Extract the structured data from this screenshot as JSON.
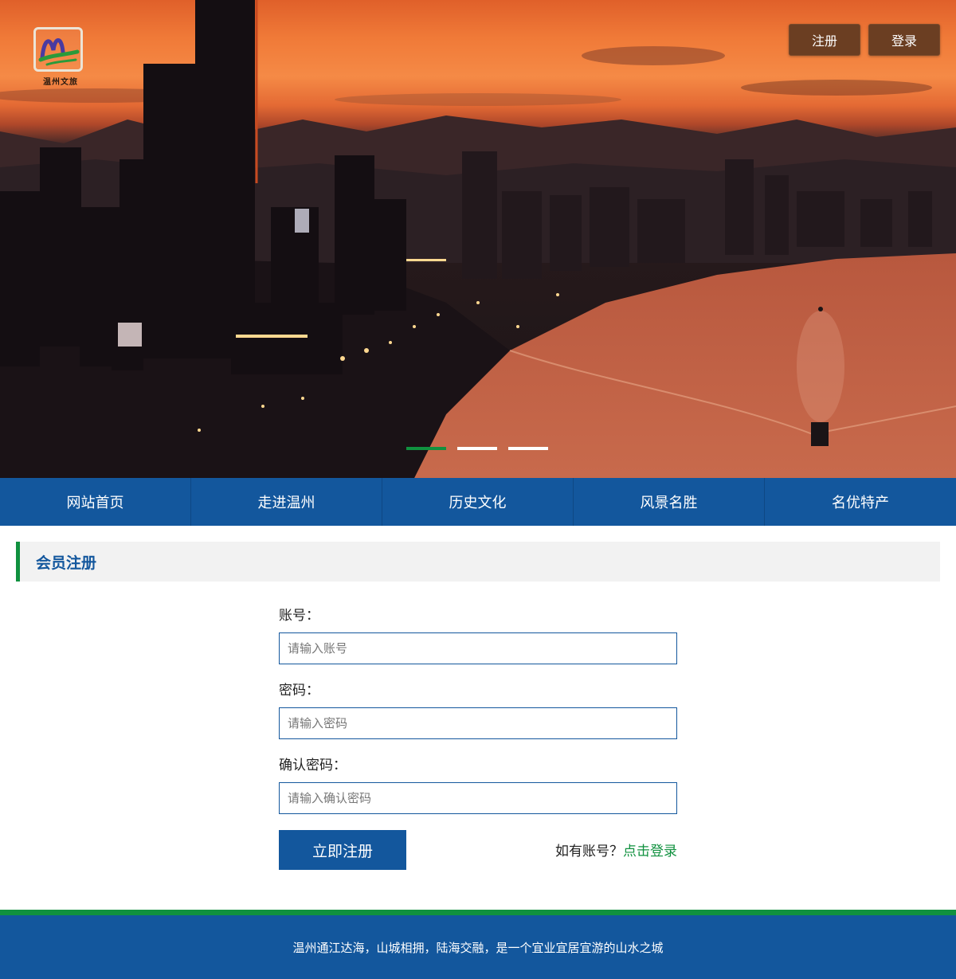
{
  "header": {
    "logo_text": "温州文旅",
    "register_label": "注册",
    "login_label": "登录"
  },
  "carousel": {
    "slide_count": 3,
    "active_index": 0
  },
  "nav": {
    "items": [
      {
        "label": "网站首页"
      },
      {
        "label": "走进温州"
      },
      {
        "label": "历史文化"
      },
      {
        "label": "风景名胜"
      },
      {
        "label": "名优特产"
      }
    ]
  },
  "section": {
    "title": "会员注册"
  },
  "form": {
    "account_label": "账号：",
    "account_placeholder": "请输入账号",
    "password_label": "密码：",
    "password_placeholder": "请输入密码",
    "confirm_label": "确认密码：",
    "confirm_placeholder": "请输入确认密码",
    "submit_label": "立即注册",
    "login_hint": "如有账号？",
    "login_link": "点击登录"
  },
  "footer": {
    "text": "温州通江达海，山城相拥，陆海交融，是一个宜业宜居宜游的山水之城"
  },
  "colors": {
    "primary_blue": "#13579d",
    "accent_green": "#10913f",
    "top_button": "#6b3e22"
  }
}
